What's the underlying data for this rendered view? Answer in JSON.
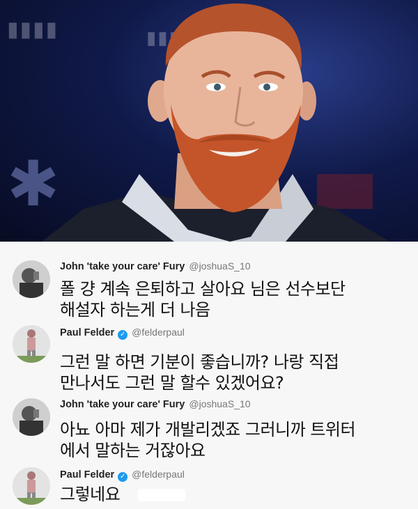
{
  "photo": {
    "description_icon": "person-photo"
  },
  "tweets": [
    {
      "name": "John 'take your care' Fury",
      "handle": "@joshuaS_10",
      "verified": false,
      "text_line1": "폴 걍 계속 은퇴하고 살아요 님은 선수보단",
      "text_line2": "해설자 하는게 더 나음"
    },
    {
      "name": "Paul Felder",
      "handle": "@felderpaul",
      "verified": true,
      "text_line1": "그런 말 하면 기분이 좋습니까? 나랑 직접",
      "text_line2": "만나서도 그런 말 할수 있겠어요?"
    },
    {
      "name": "John 'take your care' Fury",
      "handle": "@joshuaS_10",
      "verified": false,
      "text_line1": "아뇨 아마 제가 개발리겠죠 그러니까 트위터",
      "text_line2": "에서 말하는 거잖아요"
    },
    {
      "name": "Paul Felder",
      "handle": "@felderpaul",
      "verified": true,
      "text_line1": "그렇네요",
      "text_line2": ""
    }
  ],
  "colors": {
    "verified": "#1d9bf0",
    "beard": "#c4552a",
    "background": "#f7f7f7"
  }
}
